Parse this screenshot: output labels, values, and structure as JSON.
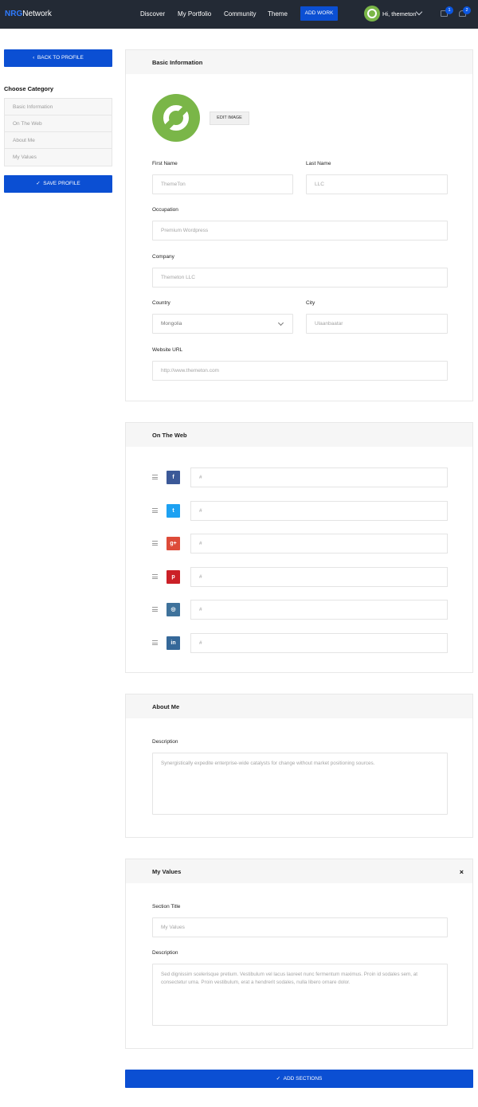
{
  "nav": {
    "logo_a": "NRG",
    "logo_b": "Network",
    "links": [
      "Discover",
      "My Portfolio",
      "Community",
      "Theme"
    ],
    "add_work": "ADD WORK",
    "user": "Hi, themeton",
    "mail_count": "1",
    "notif_count": "2"
  },
  "sidebar": {
    "back": "BACK TO PROFILE",
    "category_title": "Choose Category",
    "items": [
      "Basic Information",
      "On The Web",
      "About Me",
      "My Values"
    ],
    "save": "SAVE PROFILE"
  },
  "basic": {
    "title": "Basic Information",
    "edit_image": "EDIT IMAGE",
    "first_name_label": "First Name",
    "first_name": "ThemeTon",
    "last_name_label": "Last Name",
    "last_name": "LLC",
    "occupation_label": "Occupation",
    "occupation": "Premium Wordpress",
    "company_label": "Company",
    "company": "Themeton LLC",
    "country_label": "Country",
    "country": "Mongolia",
    "city_label": "City",
    "city": "Ulaanbaatar",
    "website_label": "Website URL",
    "website": "http://www.themeton.com"
  },
  "web": {
    "title": "On The Web",
    "rows": [
      {
        "network": "facebook",
        "glyph": "f",
        "color": "#3b5998",
        "value": "#"
      },
      {
        "network": "twitter",
        "glyph": "t",
        "color": "#1da1f2",
        "value": "#"
      },
      {
        "network": "google-plus",
        "glyph": "g+",
        "color": "#dd4b39",
        "value": "#"
      },
      {
        "network": "pinterest",
        "glyph": "p",
        "color": "#cb2027",
        "value": "#"
      },
      {
        "network": "instagram",
        "glyph": "◎",
        "color": "#3f729b",
        "value": "#"
      },
      {
        "network": "linkedin",
        "glyph": "in",
        "color": "#356899",
        "value": "#"
      }
    ]
  },
  "about": {
    "title": "About Me",
    "desc_label": "Description",
    "desc": "Synergistically expedite enterprise-wide catalysts for change without market positioning sources."
  },
  "values": {
    "title": "My Values",
    "close": "×",
    "section_title_label": "Section Title",
    "section_title": "My Values",
    "desc_label": "Description",
    "desc": "Sed dignissim scelerisque pretium. Vestibulum vel lacus laoreet nunc fermentum maximus. Proin id sodales sem, at consectetur urna. Proin vestibulum, erat a hendrerit sodales, nulla libero ornare dolor."
  },
  "add_sections": "ADD SECTIONS",
  "colors": {
    "primary": "#0b4fd3",
    "topbar": "#232a35",
    "avatar": "#7ab648"
  }
}
